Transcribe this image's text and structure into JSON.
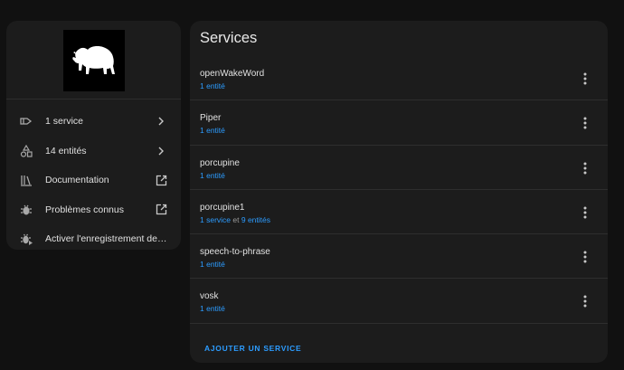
{
  "device": {
    "logo_icon": "bison-icon"
  },
  "nav": {
    "items": [
      {
        "label": "1 service",
        "icon": "service-icon",
        "trail": "chevron-right-icon"
      },
      {
        "label": "14 entités",
        "icon": "shapes-icon",
        "trail": "chevron-right-icon"
      },
      {
        "label": "Documentation",
        "icon": "books-icon",
        "trail": "open-in-new-icon"
      },
      {
        "label": "Problèmes connus",
        "icon": "bug-icon",
        "trail": "open-in-new-icon"
      },
      {
        "label": "Activer l'enregistrement des jo...",
        "icon": "bug-play-icon",
        "trail": ""
      }
    ]
  },
  "services": {
    "title": "Services",
    "items": [
      {
        "name": "openWakeWord",
        "entities": "1 entité"
      },
      {
        "name": "Piper",
        "entities": "1 entité"
      },
      {
        "name": "porcupine",
        "entities": "1 entité"
      },
      {
        "name": "porcupine1",
        "service": "1 service",
        "joiner": "et",
        "entities": "9 entités"
      },
      {
        "name": "speech-to-phrase",
        "entities": "1 entité"
      },
      {
        "name": "vosk",
        "entities": "1 entité"
      }
    ],
    "add_label": "AJOUTER UN SERVICE"
  },
  "colors": {
    "accent": "#2c9cff",
    "card": "#1c1c1c",
    "background": "#111111"
  }
}
